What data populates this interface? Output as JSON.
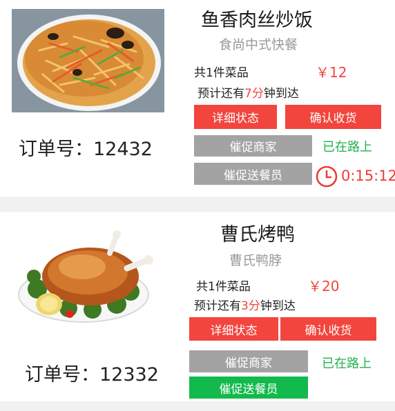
{
  "orders": [
    {
      "dish_name": "鱼香肉丝炒饭",
      "shop_name": "食尚中式快餐",
      "item_count": "共1件菜品",
      "price": "￥12",
      "eta_prefix": "预计还有",
      "eta_minutes": "7分",
      "eta_suffix": "钟到达",
      "order_no": "订单号：12432",
      "detail_label": "详细状态",
      "confirm_label": "确认收货",
      "urge_shop_label": "催促商家",
      "urge_rider_label": "催促送餐员",
      "status": "已在路上",
      "countdown": "0:15:12",
      "icon": "clock-icon"
    },
    {
      "dish_name": "曹氏烤鸭",
      "shop_name": "曹氏鸭脖",
      "item_count": "共1件菜品",
      "price": "￥20",
      "eta_prefix": "预计还有",
      "eta_minutes": "3分",
      "eta_suffix": "钟到达",
      "order_no": "订单号：12332",
      "detail_label": "详细状态",
      "confirm_label": "确认收货",
      "urge_shop_label": "催促商家",
      "urge_rider_label": "催促送餐员",
      "status": "已在路上"
    }
  ],
  "colors": {
    "accent_red": "#f2453d",
    "button_gray": "#a3a3a3",
    "button_green": "#12ba4b",
    "status_green": "#22b24c",
    "muted_text": "#999999"
  }
}
